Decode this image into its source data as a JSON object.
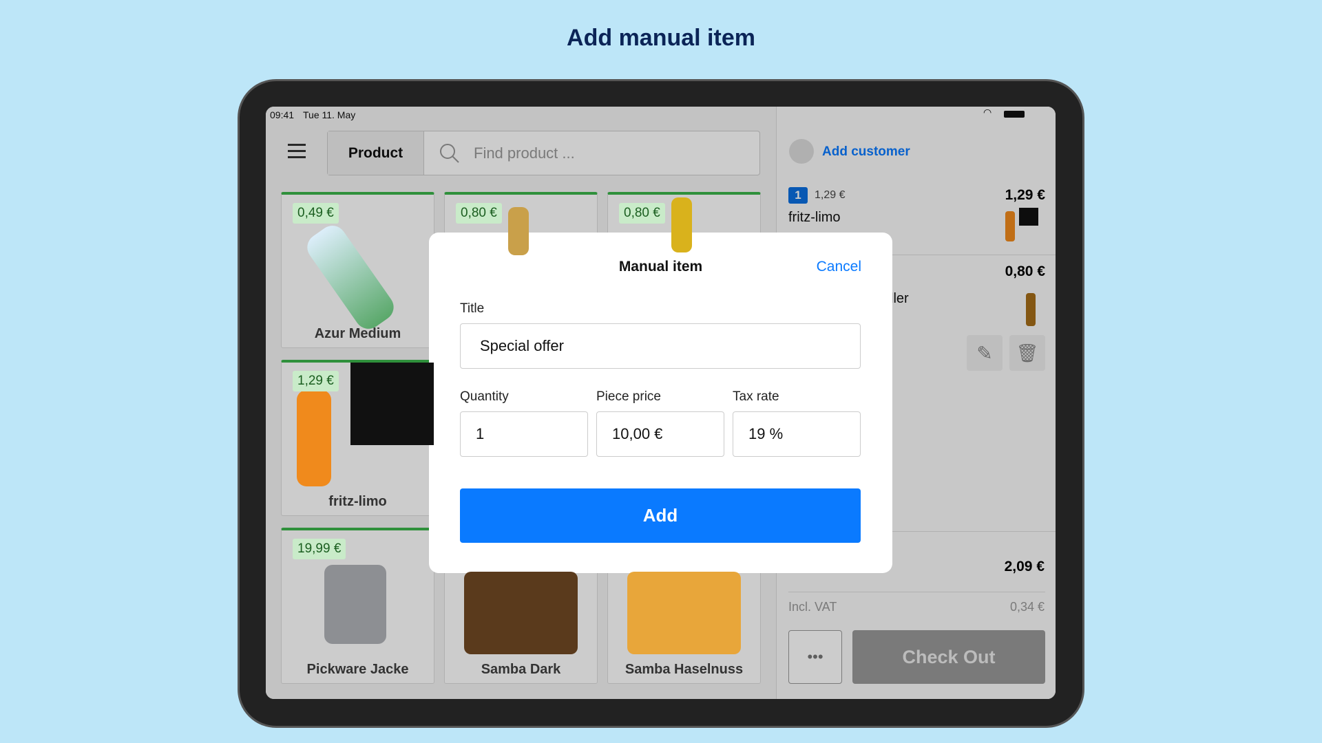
{
  "page_title": "Add manual item",
  "status": {
    "time": "09:41",
    "date": "Tue 11. May"
  },
  "toolbar": {
    "segment_label": "Product",
    "search_placeholder": "Find product ..."
  },
  "products": [
    {
      "name": "Azur Medium",
      "price": "0,49 €"
    },
    {
      "name": "",
      "price": "0,80 €"
    },
    {
      "name": "",
      "price": "0,80 €"
    },
    {
      "name": "fritz-limo",
      "price": "1,29 €"
    },
    {
      "name": "Pickware Jacke",
      "price": "19,99 €"
    },
    {
      "name": "Samba Dark",
      "price": ""
    },
    {
      "name": "Samba Haselnuss",
      "price": ""
    }
  ],
  "cart": {
    "add_customer": "Add customer",
    "items": [
      {
        "qty": "1",
        "unit_price": "1,29 €",
        "name": "fritz-limo",
        "total": "1,29 €"
      },
      {
        "name_partial": "ller",
        "total": "0,80 €"
      }
    ],
    "total": "2,09 €",
    "vat_label": "Incl. VAT",
    "vat_value": "0,34 €",
    "more_label": "•••",
    "checkout_label": "Check Out"
  },
  "modal": {
    "title": "Manual item",
    "cancel": "Cancel",
    "title_label": "Title",
    "title_value": "Special offer",
    "quantity_label": "Quantity",
    "quantity_value": "1",
    "price_label": "Piece price",
    "price_value": "10,00 €",
    "tax_label": "Tax rate",
    "tax_value": "19 %",
    "add_label": "Add"
  },
  "colors": {
    "accent": "#0a7aff",
    "price_tag": "#c9ebc9",
    "tile_border": "#3bb54a",
    "background": "#bde6f8"
  }
}
